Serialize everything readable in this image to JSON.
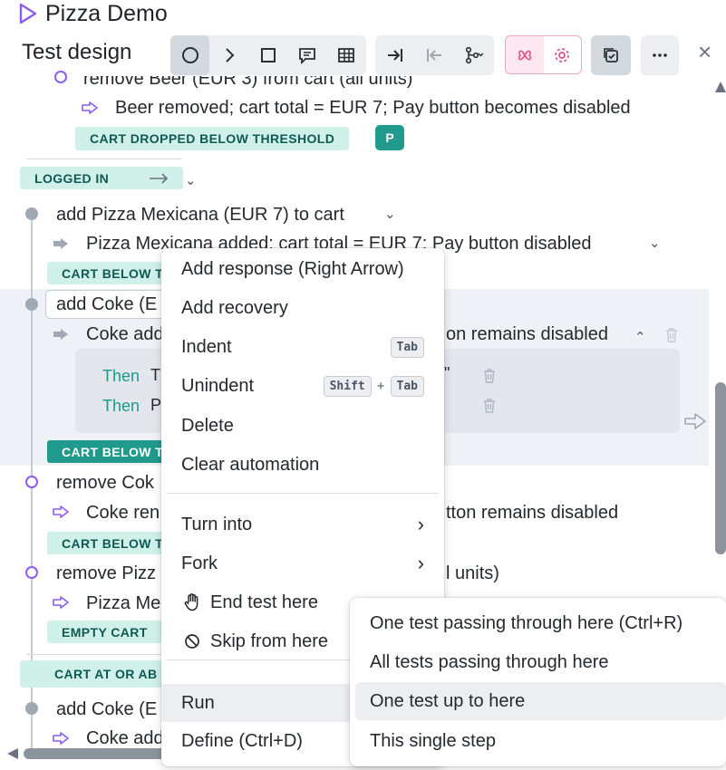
{
  "app": {
    "title": "Pizza Demo"
  },
  "panel": {
    "title": "Test design",
    "close": "×"
  },
  "rows": {
    "remove_beer": "remove Beer (EUR 3) from cart (all units)",
    "beer_removed": "Beer removed; cart total = EUR 7; Pay button becomes disabled",
    "badge_dropped": "CART DROPPED BELOW THRESHOLD",
    "avatar": "P",
    "badge_logged_in": "LOGGED IN",
    "add_pizza": "add Pizza Mexicana (EUR 7) to cart",
    "pizza_added": "Pizza Mexicana added; cart total = EUR 7; Pay button disabled",
    "badge_below_1": "CART BELOW T",
    "add_coke": "add Coke (E",
    "coke_added_start": "Coke add",
    "coke_added_end": "on remains disabled",
    "then": "Then",
    "then_1_text": "T",
    "then_1_quote": "\"",
    "then_2_text": "P",
    "badge_below_2": "CART BELOW T",
    "remove_coke": "remove Cok",
    "coke_removed_start": "Coke ren",
    "coke_removed_end": "tton remains disabled",
    "badge_below_3": "CART BELOW T",
    "remove_pizza": "remove Pizz",
    "remove_pizza_end": "l units)",
    "pizza_removed": "Pizza Me",
    "badge_empty": "EMPTY CART",
    "badge_at_or_above": "CART AT OR AB",
    "add_coke_2": "add Coke (E",
    "coke_added_2": "Coke add"
  },
  "context_menu": {
    "add_response": "Add response (Right Arrow)",
    "add_recovery": "Add recovery",
    "indent": "Indent",
    "indent_key": "Tab",
    "unindent": "Unindent",
    "unindent_key1": "Shift",
    "unindent_plus": "+",
    "unindent_key2": "Tab",
    "delete": "Delete",
    "clear_automation": "Clear automation",
    "turn_into": "Turn into",
    "fork": "Fork",
    "end_test": "End test here",
    "skip_from": "Skip from here",
    "run": "Run",
    "define": "Define (Ctrl+D)"
  },
  "run_submenu": {
    "one_test_through": "One test passing through here (Ctrl+R)",
    "all_tests_through": "All tests passing through here",
    "one_test_up_to": "One test up to here",
    "single_step": "This single step"
  },
  "colors": {
    "accent": "#8b5cf6",
    "teal_badge": "#cff1ea",
    "pink": "#e0508a"
  }
}
